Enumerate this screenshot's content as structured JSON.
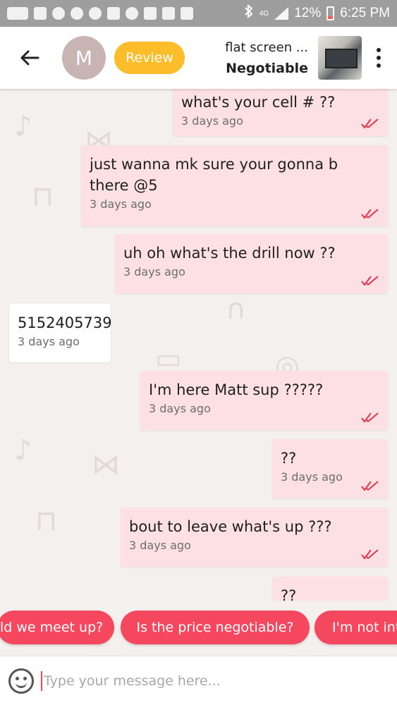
{
  "status_bar": {
    "battery_percent": "12%",
    "time": "6:25 PM",
    "network_label": "4G"
  },
  "header": {
    "avatar_initial": "M",
    "review_label": "Review",
    "listing_title": "flat screen ...",
    "listing_price": "Negotiable"
  },
  "messages": [
    {
      "direction": "out",
      "text": "what's your cell # ??",
      "time": "3 days ago",
      "read": true
    },
    {
      "direction": "out",
      "text": "just wanna mk sure your gonna b there @5",
      "time": "3 days ago",
      "read": true
    },
    {
      "direction": "out",
      "text": "uh oh what's the drill now ??",
      "time": "3 days ago",
      "read": true
    },
    {
      "direction": "in",
      "text": "5152405739",
      "time": "3 days ago",
      "read": false
    },
    {
      "direction": "out",
      "text": "I'm here Matt sup ?????",
      "time": "3 days ago",
      "read": true
    },
    {
      "direction": "out",
      "text": "??",
      "time": "3 days ago",
      "read": true
    },
    {
      "direction": "out",
      "text": "bout to leave what's up ???",
      "time": "3 days ago",
      "read": true
    },
    {
      "direction": "out",
      "text": "??",
      "time": "",
      "read": false
    }
  ],
  "quick_replies": [
    "ld we meet up?",
    "Is the price negotiable?",
    "I'm not int"
  ],
  "composer": {
    "placeholder": "Type your message here..."
  },
  "colors": {
    "accent_red": "#f5475e",
    "review_yellow": "#fbbe2a",
    "outgoing_bubble": "#fde0e3",
    "incoming_bubble": "#ffffff",
    "read_tick": "#e8334a"
  }
}
